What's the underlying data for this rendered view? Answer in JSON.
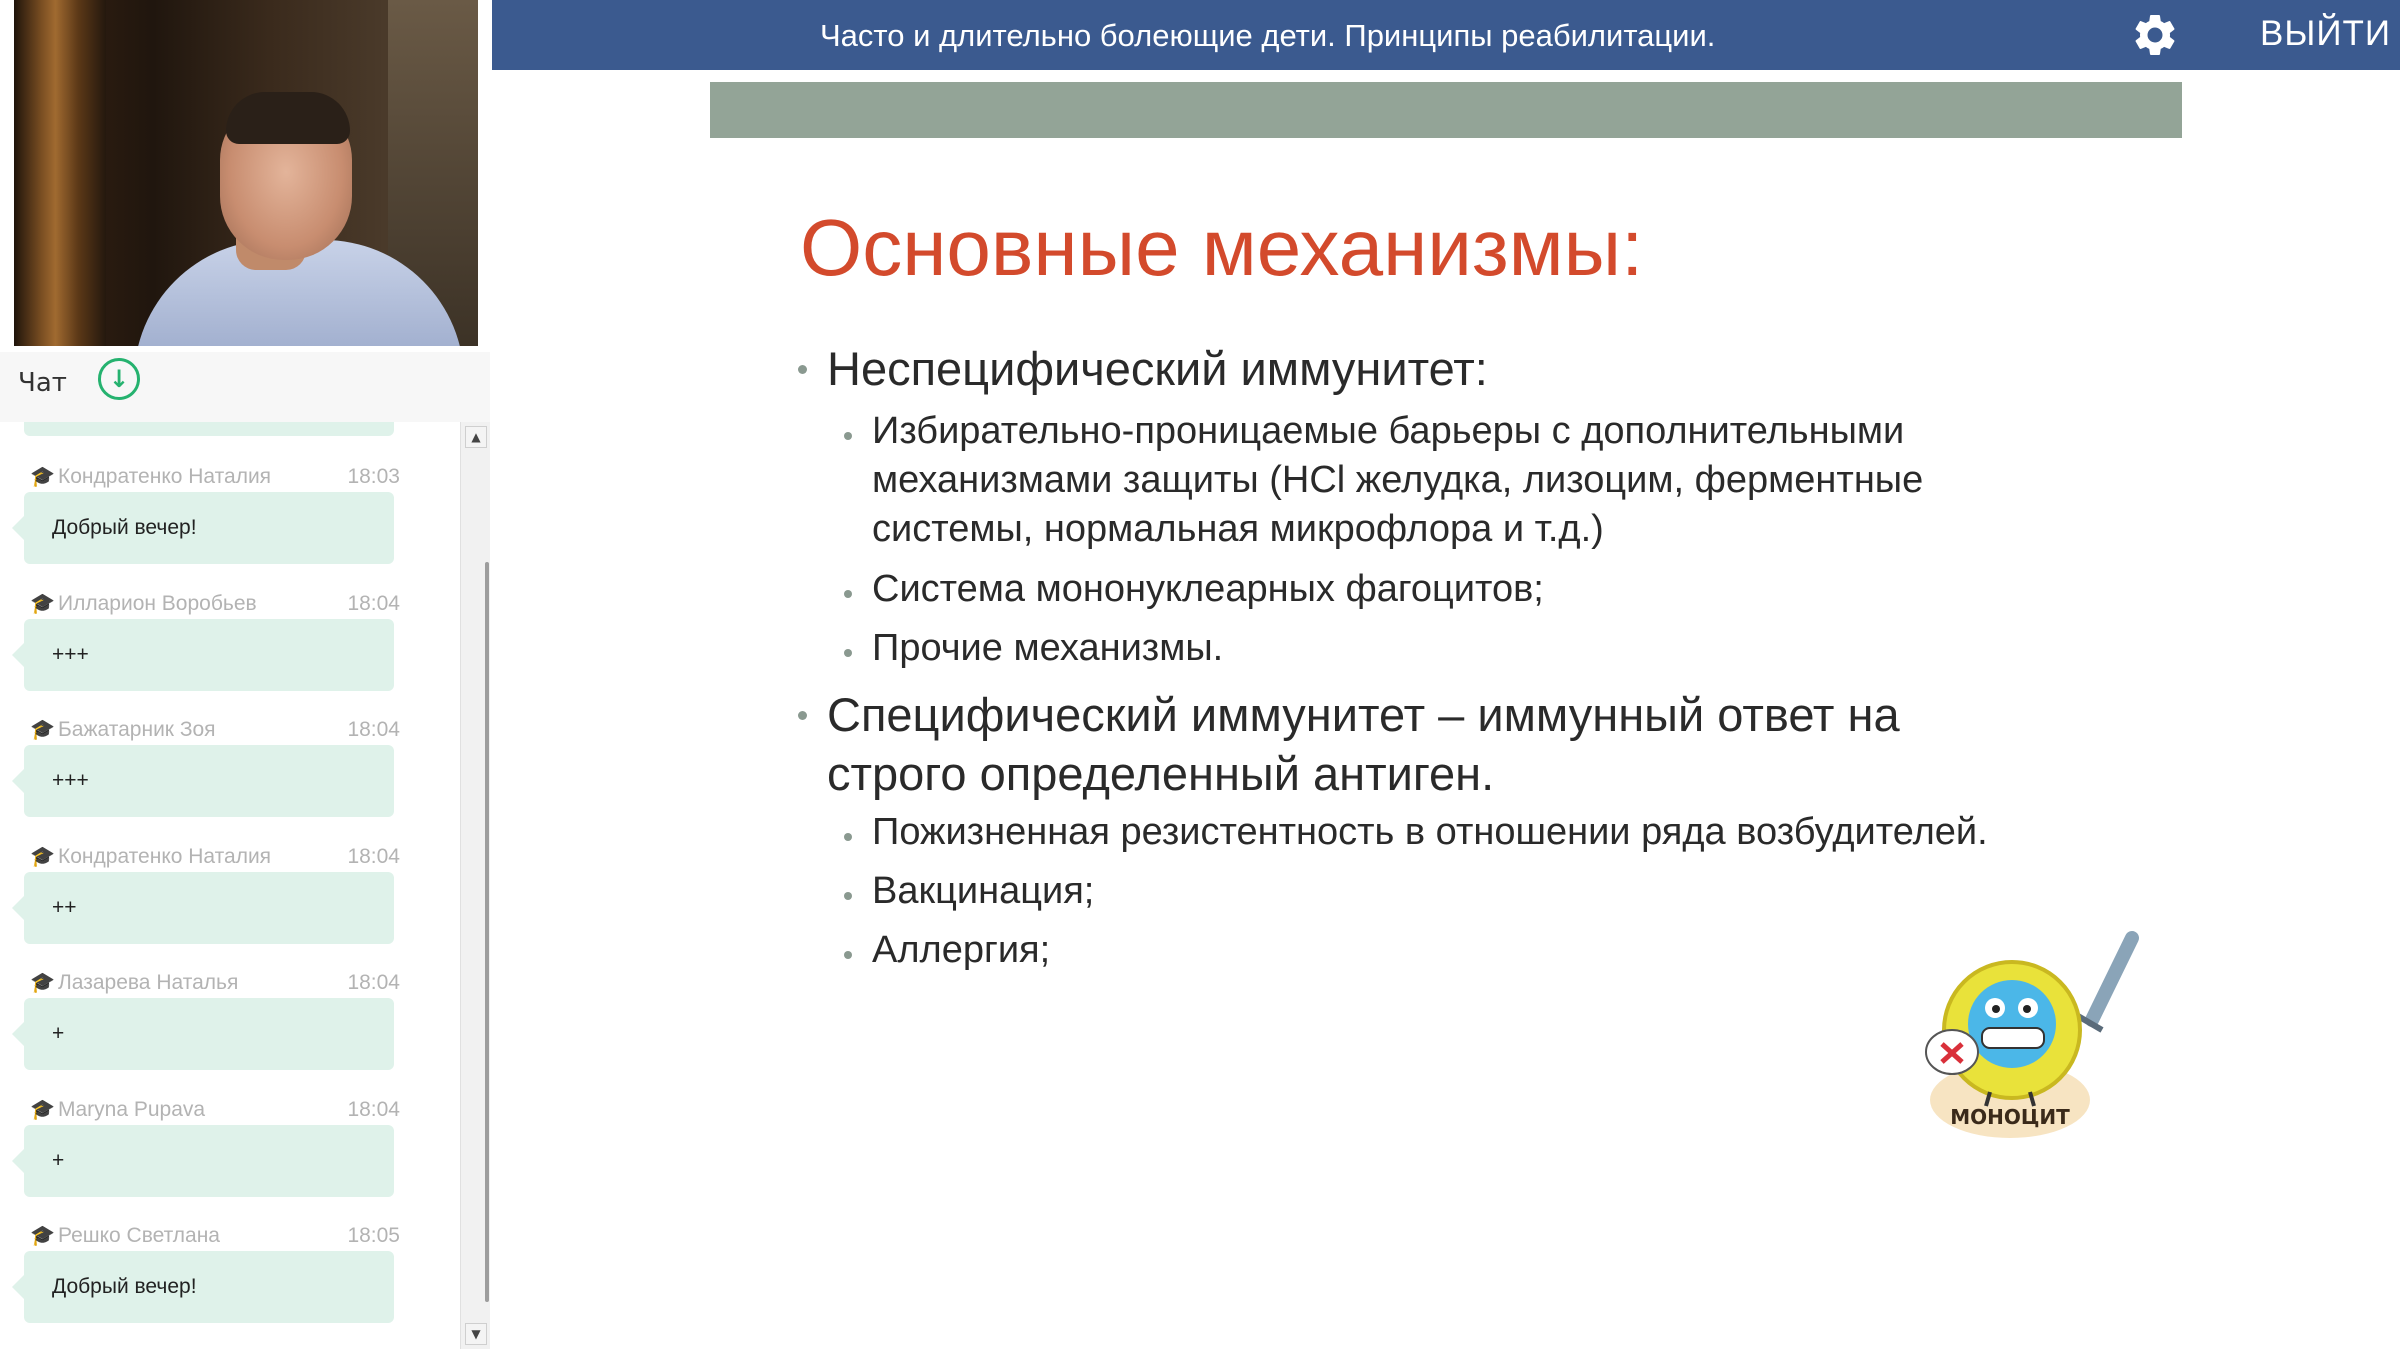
{
  "app": {
    "title": "Часто и длительно болеющие дети. Принципы реабилитации.",
    "logout_label": "ВЫЙТИ",
    "settings_icon": "gear-icon",
    "colors": {
      "topbar": "#3b5a8f",
      "chat_bubble": "#dff2ea",
      "accent_green": "#25b26f",
      "slide_heading": "#d34a2c"
    }
  },
  "chat": {
    "title": "Чат",
    "download_icon": "arrow-down-circle-icon",
    "messages": [
      {
        "author": "Кондратенко Наталия",
        "time": "18:03",
        "text": "Добрый вечер!"
      },
      {
        "author": "Илларион Воробьев",
        "time": "18:04",
        "text": "+++"
      },
      {
        "author": "Бажатарник Зоя",
        "time": "18:04",
        "text": "+++"
      },
      {
        "author": "Кондратенко Наталия",
        "time": "18:04",
        "text": "++"
      },
      {
        "author": "Лазарева Наталья",
        "time": "18:04",
        "text": "+"
      },
      {
        "author": "Maryna Pupava",
        "time": "18:04",
        "text": "+"
      },
      {
        "author": "Решко Светлана",
        "time": "18:05",
        "text": "Добрый вечер!"
      }
    ]
  },
  "slide": {
    "heading": "Основные механизмы:",
    "bullet1": "Неспецифический иммунитет:",
    "bullet1_sub1_line1": "Избирательно-проницаемые барьеры с дополнительными",
    "bullet1_sub1_line2": "механизмами защиты (HCl желудка, лизоцим, ферментные",
    "bullet1_sub1_line3": "системы, нормальная микрофлора  и т.д.)",
    "bullet1_sub2": "Система мононуклеарных фагоцитов;",
    "bullet1_sub3": "Прочие механизмы.",
    "bullet2_line1": "Специфический иммунитет – иммунный ответ на",
    "bullet2_line2": "строго определенный антиген.",
    "bullet2_sub1": "Пожизненная резистентность в отношении ряда возбудителей.",
    "bullet2_sub2": "Вакцинация;",
    "bullet2_sub3": "Аллергия;",
    "mascot_label": "МОНОЦИТ"
  }
}
